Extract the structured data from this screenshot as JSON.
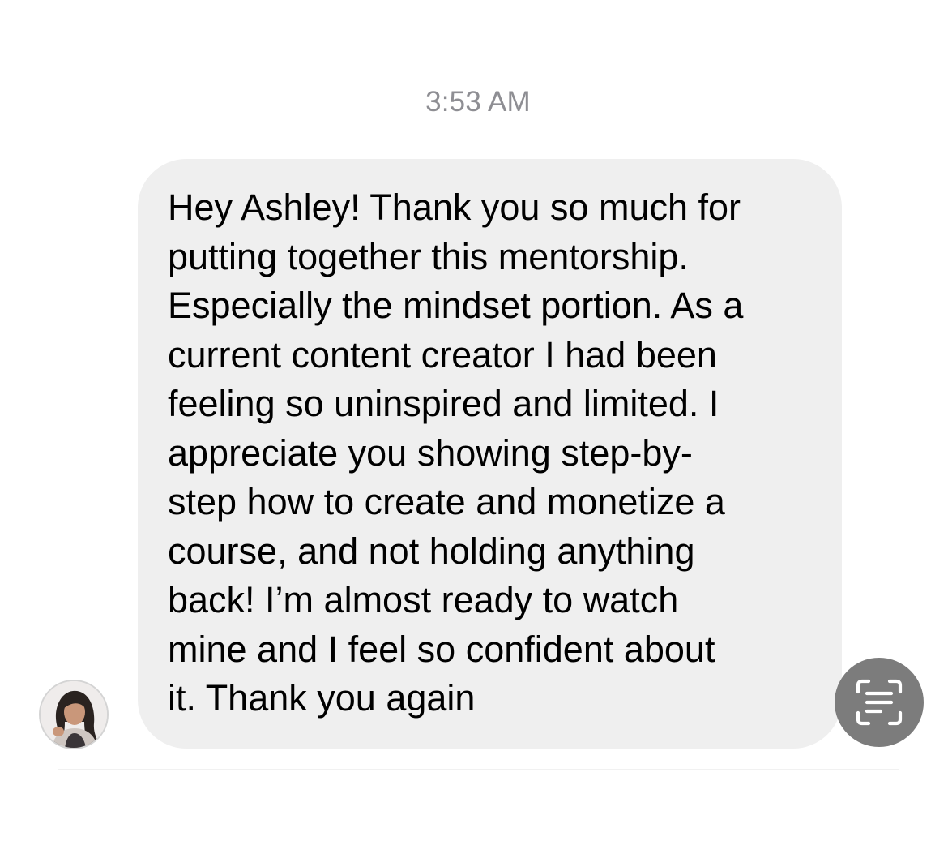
{
  "thread": {
    "timestamp": "3:53 AM"
  },
  "message": {
    "lines": [
      "Hey Ashley! Thank you so much for",
      "putting together this mentorship.",
      "Especially the mindset portion. As a",
      "current content creator I had been",
      "feeling so uninspired and limited. I",
      "appreciate you showing step-by-",
      "step how to create and monetize a",
      "course, and not holding anything",
      "back! I’m almost ready to watch",
      "mine and I feel so confident about",
      "it. Thank you again"
    ]
  },
  "sender": {
    "avatar_icon": "profile-photo"
  },
  "actions": {
    "scan_icon": "live-text-scan-icon"
  },
  "colors": {
    "bubble": "#efefef",
    "timestamp": "#8e8e93",
    "scan_button": "#7c7c7c"
  }
}
